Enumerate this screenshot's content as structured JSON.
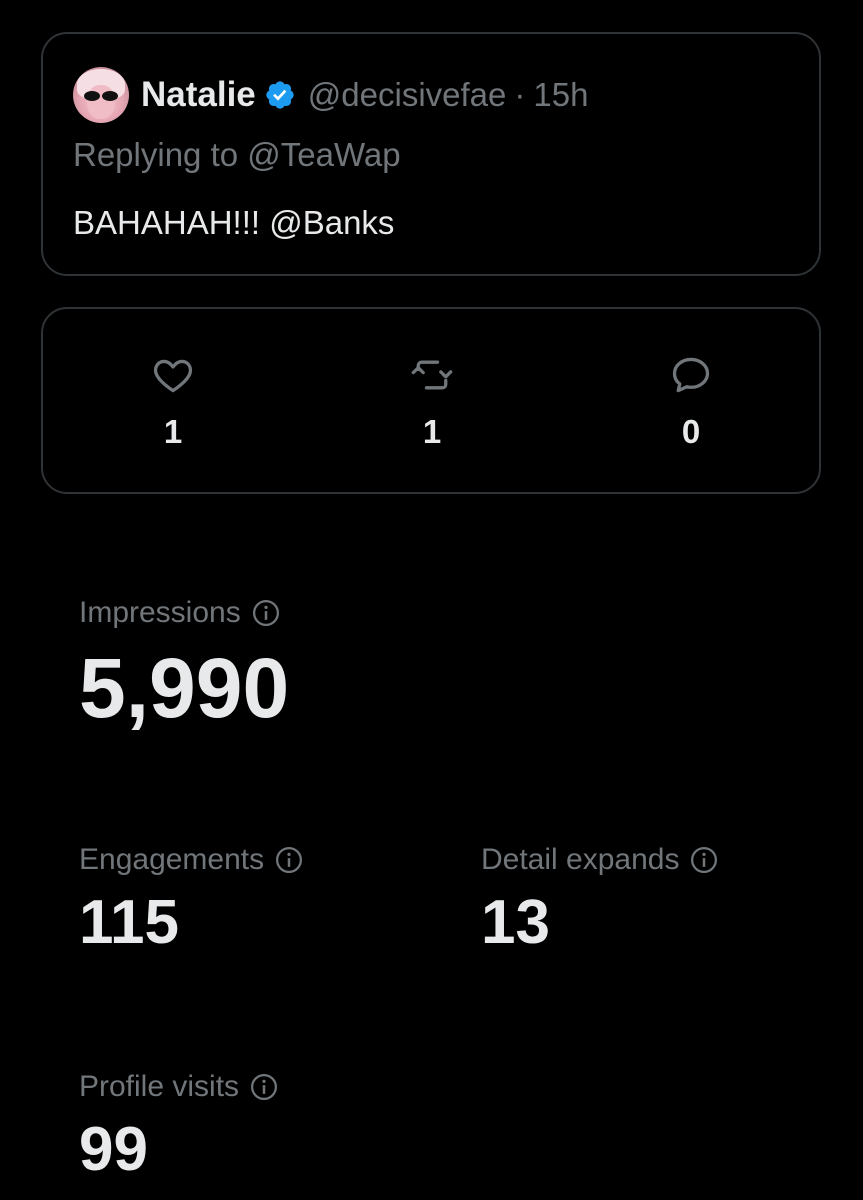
{
  "tweet": {
    "name": "Natalie",
    "handle": "@decisivefae",
    "separator": "·",
    "time": "15h",
    "replying_to": "Replying to @TeaWap",
    "text": "BAHAHAH!!! @Banks"
  },
  "stats": [
    {
      "icon": "heart-icon",
      "count": "1"
    },
    {
      "icon": "retweet-icon",
      "count": "1"
    },
    {
      "icon": "reply-icon",
      "count": "0"
    }
  ],
  "metrics": {
    "impressions": {
      "label": "Impressions",
      "value": "5,990"
    },
    "engagements": {
      "label": "Engagements",
      "value": "115"
    },
    "detail_expands": {
      "label": "Detail expands",
      "value": "13"
    },
    "profile_visits": {
      "label": "Profile visits",
      "value": "99"
    }
  },
  "colors": {
    "background": "#000000",
    "text": "#e7e9ea",
    "muted": "#71767b",
    "border": "#2f3336",
    "verified": "#1d9bf0"
  }
}
